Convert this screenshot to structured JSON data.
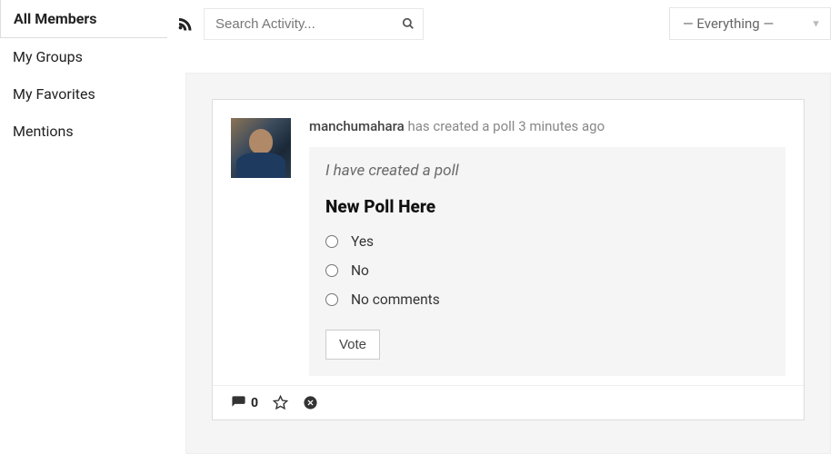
{
  "sidebar": {
    "items": [
      {
        "label": "All Members",
        "active": true
      },
      {
        "label": "My Groups",
        "active": false
      },
      {
        "label": "My Favorites",
        "active": false
      },
      {
        "label": "Mentions",
        "active": false
      }
    ]
  },
  "topbar": {
    "search_placeholder": "Search Activity...",
    "filter_label": "— Everything —"
  },
  "activity": {
    "author": "manchumahara",
    "action_text": "has created a poll",
    "time_text": "3 minutes ago",
    "poll": {
      "caption": "I have created a poll",
      "title": "New Poll Here",
      "options": [
        {
          "label": "Yes"
        },
        {
          "label": "No"
        },
        {
          "label": "No comments"
        }
      ],
      "vote_label": "Vote"
    },
    "footer": {
      "comment_count": "0"
    }
  }
}
